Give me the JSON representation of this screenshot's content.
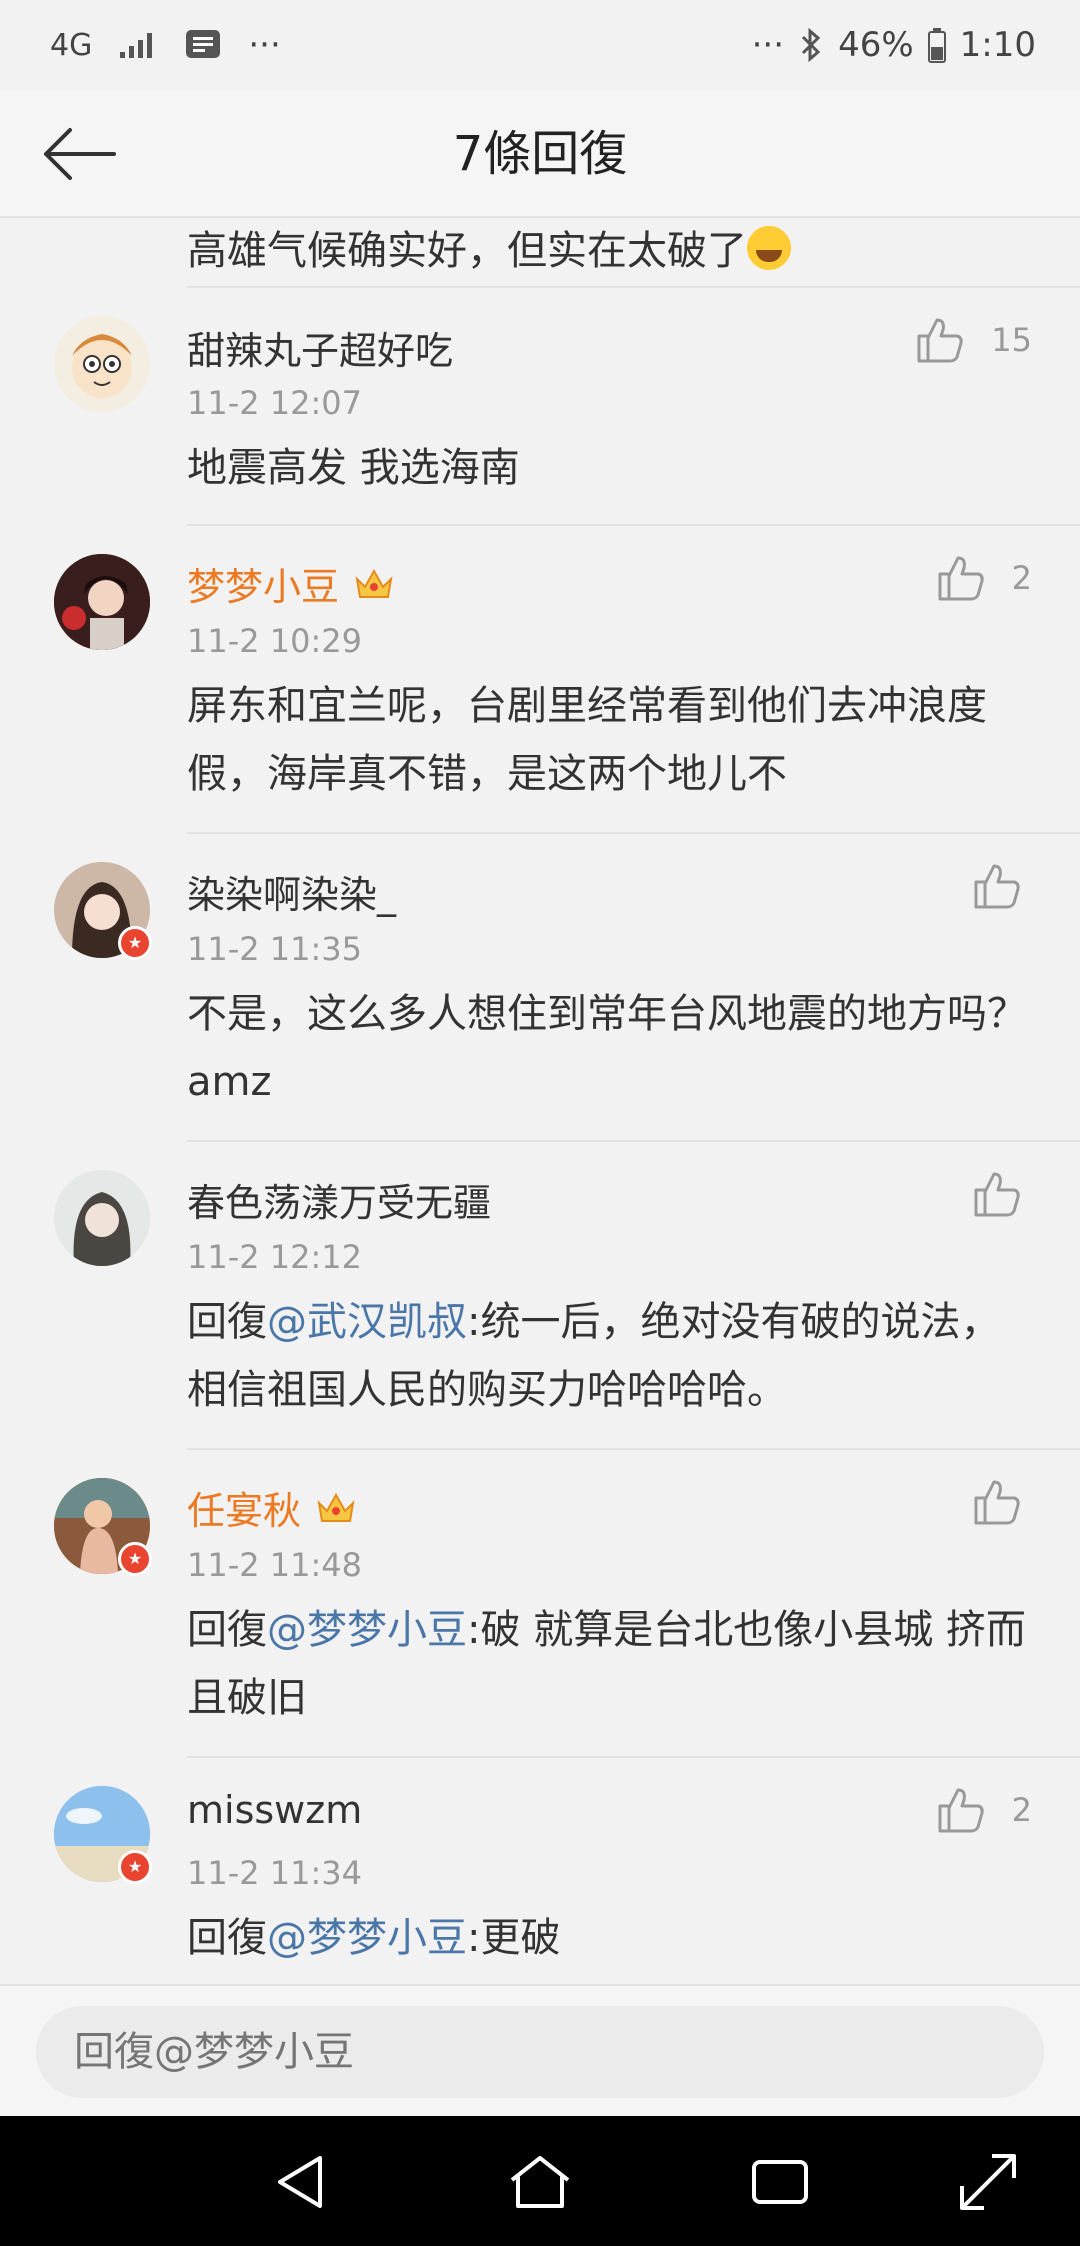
{
  "status_bar": {
    "network": "4G",
    "battery": "46%",
    "time": "1:10",
    "dots": "···"
  },
  "header": {
    "title": "7條回復"
  },
  "previous_comment": {
    "text": "高雄气候确实好，但实在太破了"
  },
  "comments": [
    {
      "name": "甜辣丸子超好吃",
      "vip": false,
      "verified": false,
      "time": "11-2 12:07",
      "likes": "15",
      "text": "地震高发 我选海南"
    },
    {
      "name": "梦梦小豆",
      "vip": true,
      "verified": false,
      "time": "11-2 10:29",
      "likes": "2",
      "text": "屏东和宜兰呢，台剧里经常看到他们去冲浪度假，海岸真不错，是这两个地儿不"
    },
    {
      "name": "染染啊染染_",
      "vip": false,
      "verified": true,
      "time": "11-2 11:35",
      "likes": "",
      "text": "不是，这么多人想住到常年台风地震的地方吗？amz"
    },
    {
      "name": "春色荡漾万受无疆",
      "vip": false,
      "verified": false,
      "time": "11-2 12:12",
      "likes": "",
      "prefix": "回復",
      "mention": "@武汉凯叔",
      "text": ":统一后，绝对没有破的说法，相信祖国人民的购买力哈哈哈哈。"
    },
    {
      "name": "任宴秋",
      "vip": true,
      "verified": true,
      "time": "11-2 11:48",
      "likes": "",
      "prefix": "回復",
      "mention": "@梦梦小豆",
      "text": ":破 就算是台北也像小县城 挤而且破旧"
    },
    {
      "name": "misswzm",
      "vip": false,
      "verified": true,
      "time": "11-2 11:34",
      "likes": "2",
      "prefix": "回復",
      "mention": "@梦梦小豆",
      "text": ":更破"
    }
  ],
  "reply_input": {
    "placeholder": "回復@梦梦小豆"
  },
  "icons": {
    "back": "back-arrow-icon",
    "like": "thumbs-up-icon",
    "crown": "vip-crown-icon"
  },
  "colors": {
    "vip_name": "#eb7a22",
    "mention": "#4a76a8",
    "verified_badge": "#e8442f"
  }
}
